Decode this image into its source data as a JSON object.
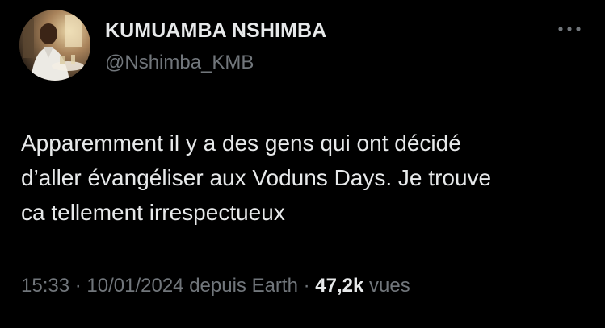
{
  "author": {
    "name": "KUMUAMBA NSHIMBA",
    "handle": "@Nshimba_KMB"
  },
  "tweet": {
    "lines": [
      "Apparemment il y a des gens qui ont décidé",
      "d’aller évangéliser aux Voduns Days. Je trouve",
      "ca tellement irrespectueux"
    ]
  },
  "meta": {
    "time": "15:33",
    "separator": " · ",
    "date": "10/01/2024",
    "source": "depuis Earth",
    "views_count": "47,2k",
    "views_label": "vues"
  },
  "colors": {
    "background": "#000000",
    "text": "#e7e9ea",
    "secondary_text": "#71767b",
    "divider": "#2f3336"
  },
  "icons": {
    "more": "more-horizontal-icon"
  }
}
